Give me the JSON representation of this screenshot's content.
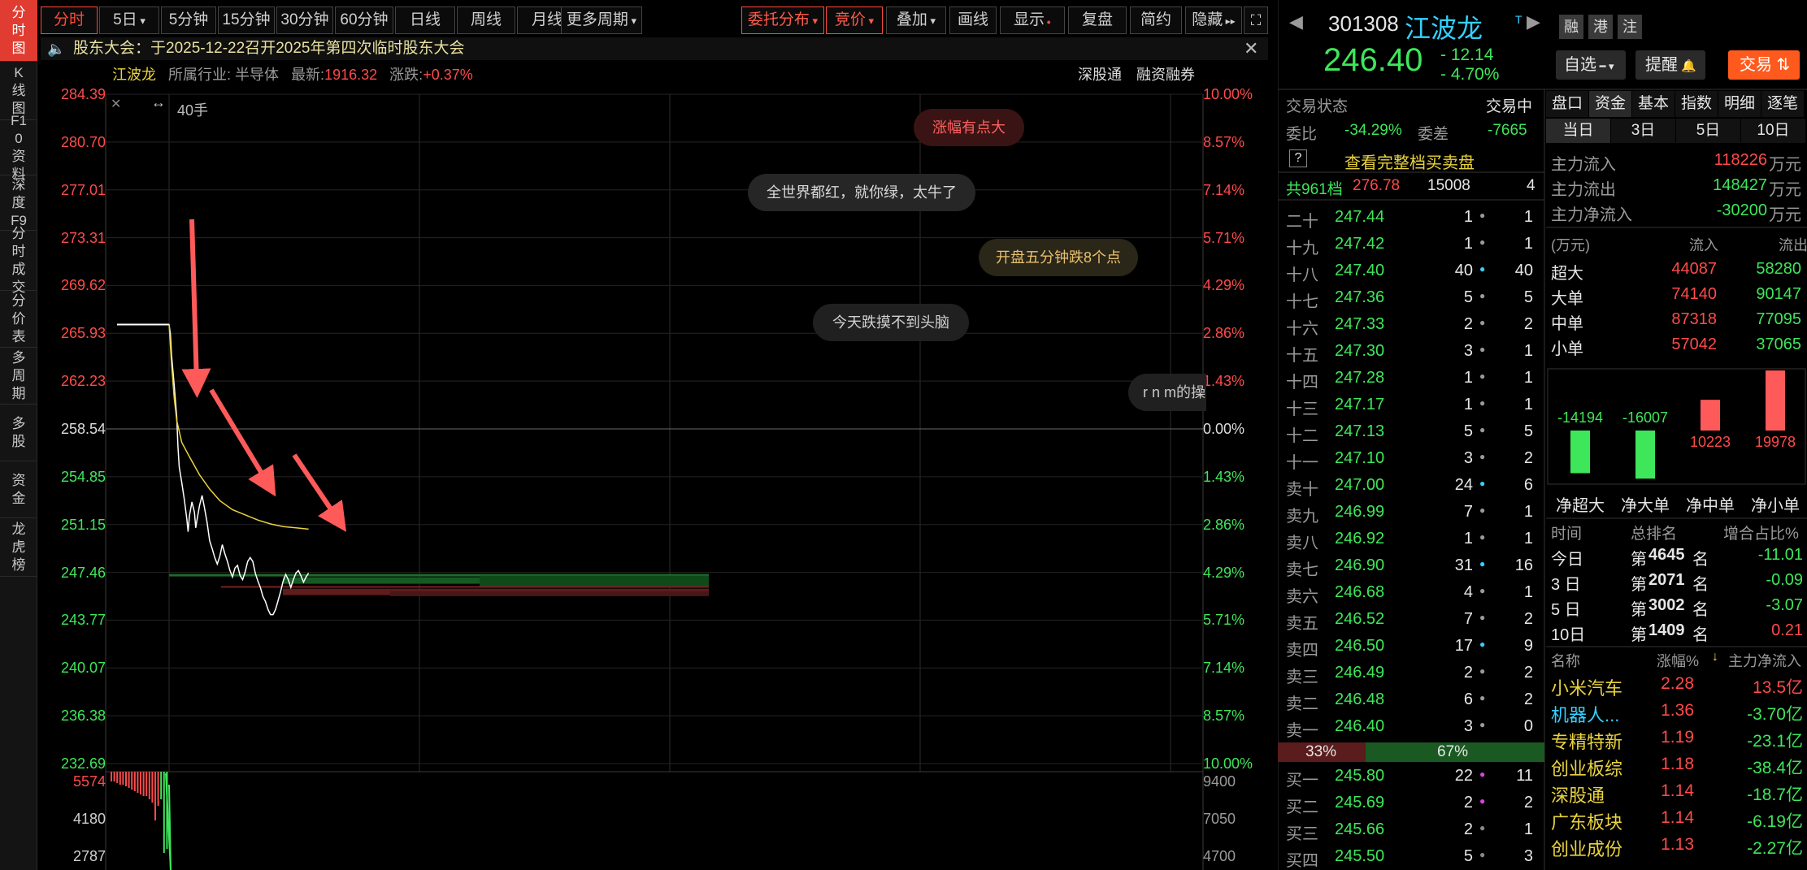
{
  "left_tabs": [
    {
      "label": "分时图",
      "active": true
    },
    {
      "label": "K线图",
      "active": false
    },
    {
      "label": "F10资料",
      "active": false
    },
    {
      "label": "深度F9",
      "active": false
    },
    {
      "label": "分时成交",
      "active": false
    },
    {
      "label": "分价表",
      "active": false
    },
    {
      "label": "多周期",
      "active": false
    },
    {
      "label": "多股",
      "active": false
    },
    {
      "label": "资金",
      "active": false
    },
    {
      "label": "龙虎榜",
      "active": false
    }
  ],
  "toolbar": {
    "periods": [
      "分时",
      "5日",
      "5分钟",
      "15分钟",
      "30分钟",
      "60分钟",
      "日线",
      "周线",
      "月线",
      "更多周期"
    ],
    "tools": [
      "委托分布",
      "竞价",
      "叠加",
      "画线",
      "显示",
      "复盘",
      "简约",
      "隐藏"
    ],
    "fullscreen_icon": "fullscreen-icon"
  },
  "notice": {
    "text": "股东大会：于2025-12-22召开2025年第四次临时股东大会",
    "icon": "speaker-icon",
    "close_icon": "close-icon"
  },
  "info": {
    "name": "江波龙",
    "industry_label": "所属行业:",
    "industry": "半导体",
    "latest_label": "最新:",
    "latest": "1916.32",
    "change_label": "涨跌:",
    "change": "+0.37%",
    "links": [
      "深股通",
      "融资融券"
    ]
  },
  "chart": {
    "price_ticks": [
      "284.39",
      "280.70",
      "277.01",
      "273.31",
      "269.62",
      "265.93",
      "262.23",
      "258.54",
      "254.85",
      "251.15",
      "247.46",
      "243.77",
      "240.07",
      "236.38",
      "232.69"
    ],
    "pct_ticks": [
      "10.00%",
      "8.57%",
      "7.14%",
      "5.71%",
      "4.29%",
      "2.86%",
      "1.43%",
      "0.00%",
      "1.43%",
      "2.86%",
      "4.29%",
      "5.71%",
      "7.14%",
      "8.57%",
      "10.00%"
    ],
    "volume_label": "40手",
    "volume_left_ticks": [
      "5574",
      "4180",
      "2787"
    ],
    "volume_right_ticks": [
      "9400",
      "7050",
      "4700"
    ],
    "bubbles": [
      "涨幅有点大",
      "全世界都红，就你绿，太牛了",
      "开盘五分钟跌8个点",
      "今天跌摸不到头脑",
      "r n m的操"
    ],
    "colors": {
      "price_up": "#ff4a4a",
      "price_down": "#3ee65a",
      "price_line": "#ffffff",
      "avg_line": "#e8d23e",
      "arrow": "#ff5a5a"
    }
  },
  "quote": {
    "code": "301308",
    "name": "江波龙",
    "price": "246.40",
    "change": "- 12.14",
    "change_pct": "- 4.70%",
    "badges": [
      "融",
      "港",
      "注"
    ],
    "t_mark": "T",
    "buttons": {
      "watchlist": "自选",
      "alert": "提醒",
      "trade": "交易"
    }
  },
  "book": {
    "status_label": "交易状态",
    "status": "交易中",
    "wb_label": "委比",
    "wb": "-34.29%",
    "wc_label": "委差",
    "wc": "-7665",
    "full_book": "查看完整档买卖盘",
    "total_label": "共961档",
    "total_price": "276.78",
    "total_vol": "15008",
    "total_cnt": "4",
    "asks": [
      {
        "label": "二十",
        "price": "247.44",
        "vol": "1",
        "cnt": "1"
      },
      {
        "label": "十九",
        "price": "247.42",
        "vol": "1",
        "cnt": "1"
      },
      {
        "label": "十八",
        "price": "247.40",
        "vol": "40",
        "cnt": "40"
      },
      {
        "label": "十七",
        "price": "247.36",
        "vol": "5",
        "cnt": "5"
      },
      {
        "label": "十六",
        "price": "247.33",
        "vol": "2",
        "cnt": "2"
      },
      {
        "label": "十五",
        "price": "247.30",
        "vol": "3",
        "cnt": "1"
      },
      {
        "label": "十四",
        "price": "247.28",
        "vol": "1",
        "cnt": "1"
      },
      {
        "label": "十三",
        "price": "247.17",
        "vol": "1",
        "cnt": "1"
      },
      {
        "label": "十二",
        "price": "247.13",
        "vol": "5",
        "cnt": "5"
      },
      {
        "label": "十一",
        "price": "247.10",
        "vol": "3",
        "cnt": "2"
      },
      {
        "label": "卖十",
        "price": "247.00",
        "vol": "24",
        "cnt": "6"
      },
      {
        "label": "卖九",
        "price": "246.99",
        "vol": "7",
        "cnt": "1"
      },
      {
        "label": "卖八",
        "price": "246.92",
        "vol": "1",
        "cnt": "1"
      },
      {
        "label": "卖七",
        "price": "246.90",
        "vol": "31",
        "cnt": "16"
      },
      {
        "label": "卖六",
        "price": "246.68",
        "vol": "4",
        "cnt": "1"
      },
      {
        "label": "卖五",
        "price": "246.52",
        "vol": "7",
        "cnt": "2"
      },
      {
        "label": "卖四",
        "price": "246.50",
        "vol": "17",
        "cnt": "9"
      },
      {
        "label": "卖三",
        "price": "246.49",
        "vol": "2",
        "cnt": "2"
      },
      {
        "label": "卖二",
        "price": "246.48",
        "vol": "6",
        "cnt": "2"
      },
      {
        "label": "卖一",
        "price": "246.40",
        "vol": "3",
        "cnt": "0"
      }
    ],
    "ratio_sell": "33%",
    "ratio_buy": "67%",
    "bids": [
      {
        "label": "买一",
        "price": "245.80",
        "vol": "22",
        "cnt": "11"
      },
      {
        "label": "买二",
        "price": "245.69",
        "vol": "2",
        "cnt": "2"
      },
      {
        "label": "买三",
        "price": "245.66",
        "vol": "2",
        "cnt": "1"
      },
      {
        "label": "买四",
        "price": "245.50",
        "vol": "5",
        "cnt": "3"
      }
    ]
  },
  "fund": {
    "tabs": [
      "盘口",
      "资金",
      "基本",
      "指数",
      "明细",
      "逐笔"
    ],
    "periods": [
      "当日",
      "3日",
      "5日",
      "10日"
    ],
    "main_in_label": "主力流入",
    "main_in": "118226",
    "main_out_label": "主力流出",
    "main_out": "148427",
    "main_net_label": "主力净流入",
    "main_net": "-30200",
    "unit": "万元",
    "table_head": [
      "(万元)",
      "流入",
      "流出"
    ],
    "rows": [
      {
        "label": "超大",
        "in": "44087",
        "out": "58280"
      },
      {
        "label": "大单",
        "in": "74140",
        "out": "90147"
      },
      {
        "label": "中单",
        "in": "87318",
        "out": "77095"
      },
      {
        "label": "小单",
        "in": "57042",
        "out": "37065"
      }
    ],
    "bars": [
      {
        "label": "净超大",
        "value": -14194
      },
      {
        "label": "净大单",
        "value": -16007
      },
      {
        "label": "净中单",
        "value": 10223
      },
      {
        "label": "净小单",
        "value": 19978
      }
    ],
    "rank_head": [
      "时间",
      "总排名",
      "增合占比%"
    ],
    "ranks": [
      {
        "period": "今日",
        "prefix": "第",
        "rank": "4645",
        "suffix": "名",
        "pct": "-11.01"
      },
      {
        "period": "3 日",
        "prefix": "第",
        "rank": "2071",
        "suffix": "名",
        "pct": "-0.09"
      },
      {
        "period": "5 日",
        "prefix": "第",
        "rank": "3002",
        "suffix": "名",
        "pct": "-3.07"
      },
      {
        "period": "10日",
        "prefix": "第",
        "rank": "1409",
        "suffix": "名",
        "pct": "0.21"
      }
    ],
    "sector_head": [
      "名称",
      "涨幅%",
      "主力净流入"
    ],
    "sectors": [
      {
        "name": "小米汽车",
        "pct": "2.28",
        "net": "13.5亿"
      },
      {
        "name": "机器人...",
        "pct": "1.36",
        "net": "-3.70亿"
      },
      {
        "name": "专精特新",
        "pct": "1.19",
        "net": "-23.1亿"
      },
      {
        "name": "创业板综",
        "pct": "1.18",
        "net": "-38.4亿"
      },
      {
        "name": "深股通",
        "pct": "1.14",
        "net": "-18.7亿"
      },
      {
        "name": "广东板块",
        "pct": "1.14",
        "net": "-6.19亿"
      },
      {
        "name": "创业成份",
        "pct": "1.13",
        "net": "-2.27亿"
      }
    ]
  }
}
